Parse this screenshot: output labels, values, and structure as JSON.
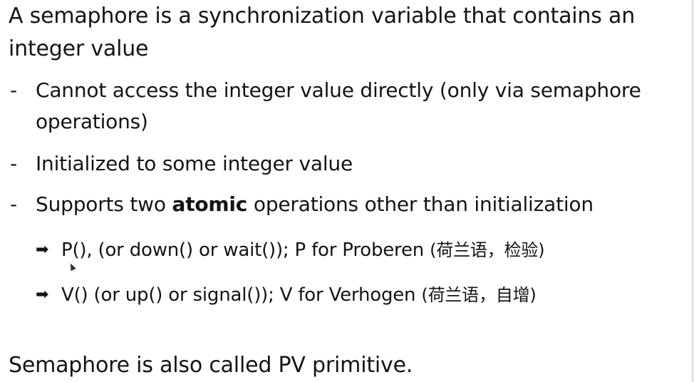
{
  "heading": "A semaphore is a synchronization variable that contains an  integer value",
  "bullets": [
    {
      "marker": "-",
      "text": "Cannot access the integer value directly (only via semaphore operations)"
    },
    {
      "marker": "-",
      "text": "Initialized to some integer value"
    },
    {
      "marker": "-",
      "pre": "Supports two ",
      "bold": "atomic",
      "post": " operations other than initialization"
    }
  ],
  "subbullets": [
    {
      "marker": "➡",
      "text": "P(), (or down() or wait()); P for Proberen ",
      "cn": "(荷兰语，检验)"
    },
    {
      "marker": "➡",
      "text": "V() (or up() or signal()); V for Verhogen ",
      "cn": "(荷兰语，自增)"
    }
  ],
  "footer": "Semaphore is also called PV primitive.",
  "icons": {
    "cursor": "mouse-pointer-icon"
  }
}
